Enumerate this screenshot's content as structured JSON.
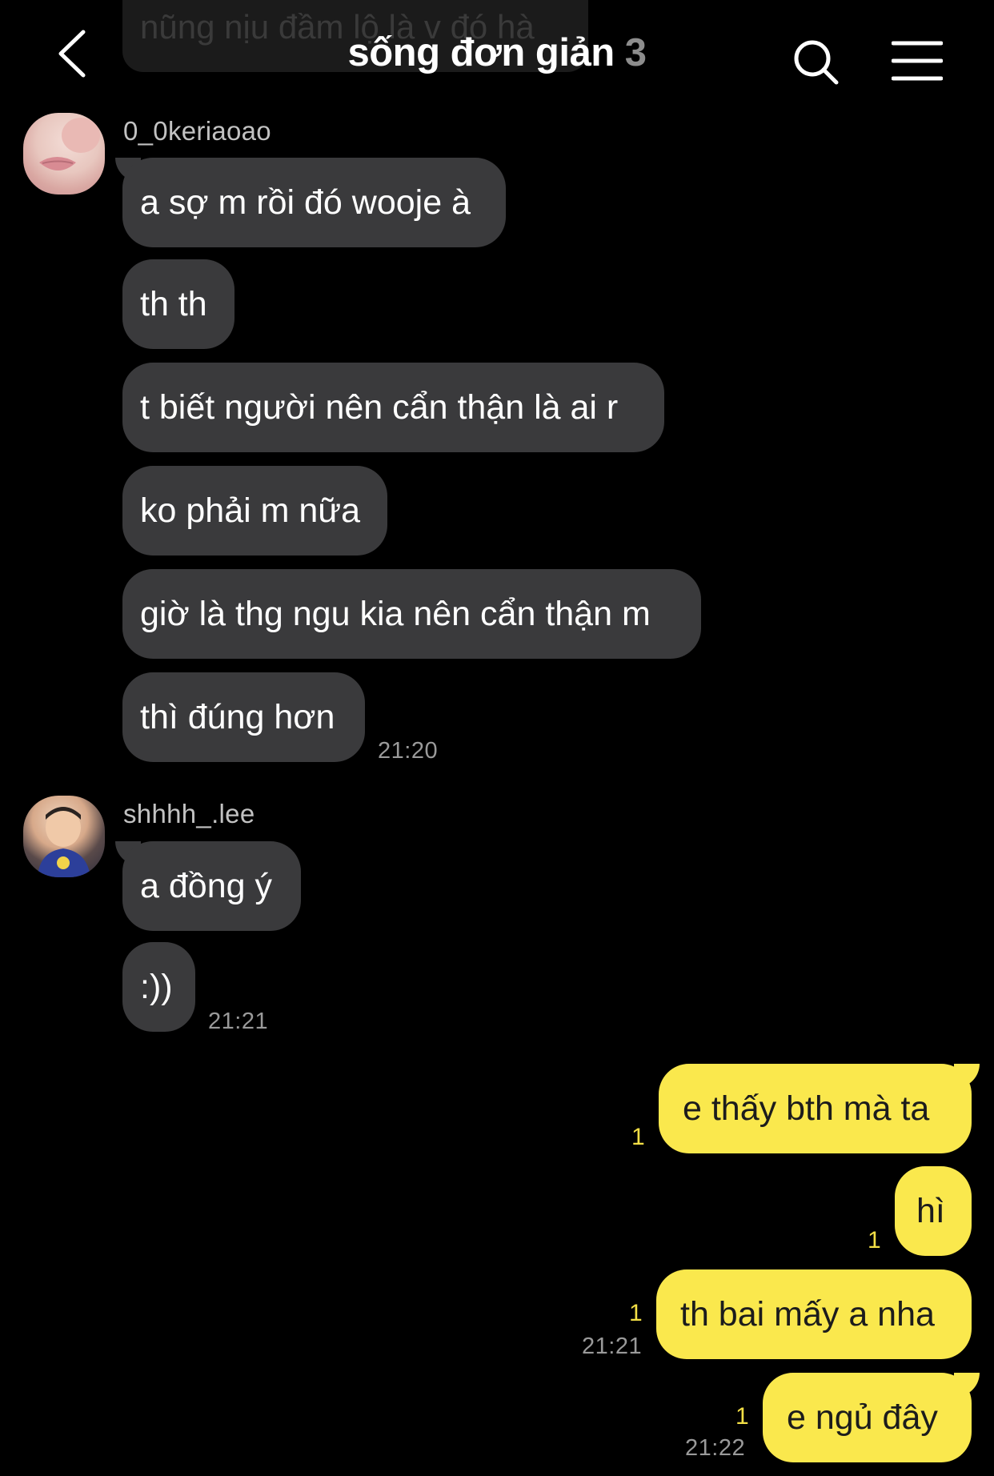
{
  "header": {
    "title": "sống đơn giản",
    "member_count": "3"
  },
  "ghost_message": "nũng nịu đầm lộ là v đó hà",
  "groups": [
    {
      "sender": "0_0keriaoao",
      "messages": [
        "a sợ m rồi đó wooje à",
        "th th",
        "t biết người nên cẩn thận là ai r",
        "ko phải m nữa",
        "giờ là thg ngu kia nên cẩn thận m",
        "thì đúng hơn"
      ],
      "time": "21:20"
    },
    {
      "sender": "shhhh_.lee",
      "messages": [
        "a đồng ý",
        ":))"
      ],
      "time": "21:21"
    }
  ],
  "outgoing": [
    {
      "text": "e thấy bth mà ta",
      "unread": "1",
      "time": ""
    },
    {
      "text": "hì",
      "unread": "1",
      "time": ""
    },
    {
      "text": "th bai mấy a nha",
      "unread": "1",
      "time": "21:21"
    },
    {
      "text": "e ngủ đây",
      "unread": "1",
      "time": "21:22"
    }
  ]
}
